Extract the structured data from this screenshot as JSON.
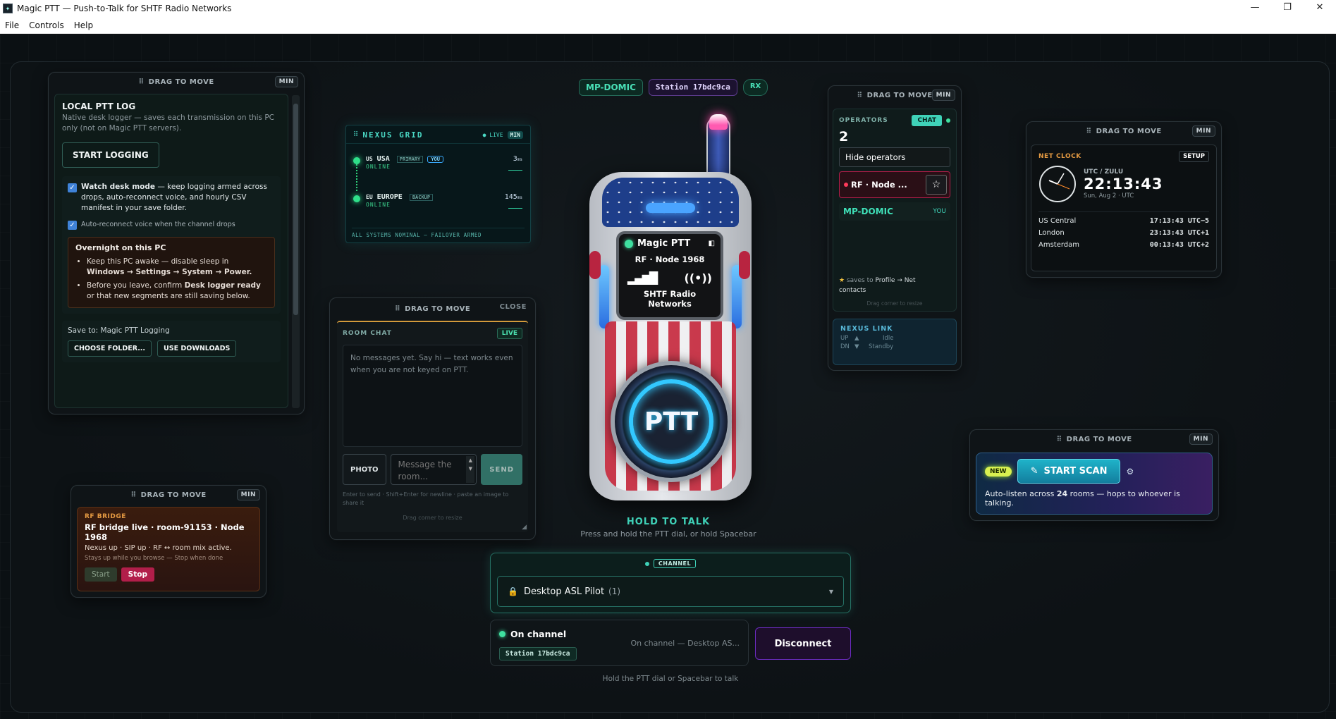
{
  "window": {
    "title": "Magic PTT — Push-to-Talk for SHTF Radio Networks",
    "minimize": "—",
    "restore": "❐",
    "close": "✕"
  },
  "menu": [
    "File",
    "Controls",
    "Help"
  ],
  "drag_label": "DRAG TO MOVE",
  "min_label": "MIN",
  "close_label": "CLOSE",
  "header_tags": {
    "callsign": "MP-DOMIC",
    "station": "Station 17bdc9ca",
    "rx": "RX"
  },
  "local_log": {
    "title": "LOCAL PTT LOG",
    "description": "Native desk logger — saves each transmission on this PC only (not on Magic PTT servers).",
    "start_button": "START LOGGING",
    "watch_label_bold": "Watch desk mode",
    "watch_label_rest": " — keep logging armed across drops, auto-reconnect voice, and hourly CSV manifest in your save folder.",
    "auto_reconnect": "Auto-reconnect voice when the channel drops",
    "overnight_title": "Overnight on this PC",
    "tip1_a": "Keep this PC awake — disable sleep in ",
    "tip1_b": "Windows → Settings → System → Power.",
    "tip2_a": "Before you leave, confirm ",
    "tip2_b": "Desk logger ready",
    "tip2_c": " or that new segments are still saving below.",
    "save_to": "Save to: Magic PTT Logging",
    "choose_folder": "CHOOSE FOLDER...",
    "use_downloads": "USE DOWNLOADS"
  },
  "nexus_grid": {
    "title": "NEXUS GRID",
    "live": "LIVE",
    "min": "MIN",
    "nodes": [
      {
        "code": "US",
        "name": "USA",
        "tag": "PRIMARY",
        "you": "YOU",
        "status": "ONLINE",
        "latency": "3",
        "unit": "ms"
      },
      {
        "code": "EU",
        "name": "EUROPE",
        "tag": "BACKUP",
        "status": "ONLINE",
        "latency": "145",
        "unit": "ms"
      }
    ],
    "footer": "ALL SYSTEMS NOMINAL — FAILOVER ARMED"
  },
  "room_chat": {
    "title": "ROOM CHAT",
    "live": "LIVE",
    "empty": "No messages yet. Say hi — text works even when you are not keyed on PTT.",
    "photo": "PHOTO",
    "placeholder": "Message the room...",
    "send": "SEND",
    "hint": "Enter to send · Shift+Enter for newline · paste an image to share it",
    "resize": "Drag corner to resize"
  },
  "radio": {
    "brand": "Magic PTT",
    "line2": "RF · Node 1968",
    "network": "SHTF Radio Networks",
    "ptt": "PTT",
    "hold": "HOLD TO TALK",
    "hold_sub": "Press and hold the PTT dial, or hold Spacebar"
  },
  "rf_bridge": {
    "label": "RF BRIDGE",
    "title": "RF bridge live · room-91153 · Node 1968",
    "status": "Nexus up · SIP up · RF ↔ room mix active.",
    "note": "Stays up while you browse — Stop when done",
    "start": "Start",
    "stop": "Stop"
  },
  "operators": {
    "title": "OPERATORS",
    "chat": "CHAT",
    "count": "2",
    "hide": "Hide operators",
    "rf_node": "RF · Node ...",
    "star": "☆",
    "me": "MP-DOMIC",
    "you": "YOU",
    "saves_a": "saves to ",
    "saves_b": "Profile → Net",
    "saves_c": "contacts",
    "resize": "Drag corner to resize",
    "link_title": "NEXUS LINK",
    "up": "UP",
    "up_state": "Idle",
    "dn": "DN",
    "dn_state": "Standby"
  },
  "net_clock": {
    "title": "NET CLOCK",
    "setup": "SETUP",
    "zone": "UTC / ZULU",
    "time": "22:13:43",
    "date": "Sun, Aug 2 · UTC",
    "zones": [
      {
        "city": "US Central",
        "time": "17:13:43",
        "offset": "UTC−5"
      },
      {
        "city": "London",
        "time": "23:13:43",
        "offset": "UTC+1"
      },
      {
        "city": "Amsterdam",
        "time": "00:13:43",
        "offset": "UTC+2"
      }
    ]
  },
  "scan": {
    "new": "NEW",
    "start": "START SCAN",
    "desc_a": "Auto-listen across ",
    "desc_b": "24",
    "desc_c": " rooms — hops to whoever is talking."
  },
  "channel": {
    "label": "CHANNEL",
    "name": "Desktop ASL Pilot",
    "count": "(1)",
    "on_channel": "On channel",
    "station": "Station 17bdc9ca",
    "on_channel_detail": "On channel — Desktop AS...",
    "disconnect": "Disconnect",
    "footer": "Hold the PTT dial or Spacebar to talk"
  },
  "colors": {
    "accent_teal": "#35d0b0",
    "ptt_glow": "#32c8ff",
    "danger": "#b21e4a",
    "purple": "#6b2bbf"
  }
}
